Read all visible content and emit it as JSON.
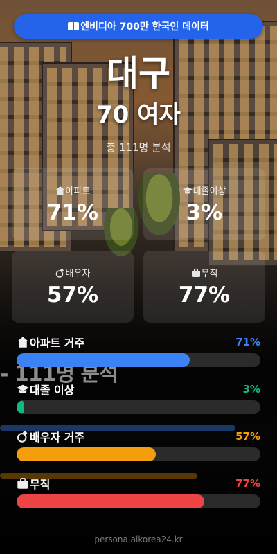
{
  "header": {
    "badge_label": "엔비디아 700만 한국인 데이터",
    "city": "대구",
    "persona": "70 여자",
    "total": "총 111명 분석"
  },
  "cards": [
    {
      "icon": "house-icon",
      "label": "아파트",
      "value": "71%"
    },
    {
      "icon": "graduation-cap-icon",
      "label": "대졸이상",
      "value": "3%"
    },
    {
      "icon": "ring-icon",
      "label": "배우자",
      "value": "57%"
    },
    {
      "icon": "briefcase-icon",
      "label": "무직",
      "value": "77%"
    }
  ],
  "progress": [
    {
      "icon": "house-icon",
      "label": "아파트 거주",
      "percent_text": "71%",
      "percent": 71,
      "color": "#3b82f6"
    },
    {
      "icon": "graduation-cap-icon",
      "label": "대졸 이상",
      "percent_text": "3%",
      "percent": 3,
      "color": "#10b981"
    },
    {
      "icon": "ring-icon",
      "label": "배우자 거주",
      "percent_text": "57%",
      "percent": 57,
      "color": "#f59e0b"
    },
    {
      "icon": "briefcase-icon",
      "label": "무직",
      "percent_text": "77%",
      "percent": 77,
      "color": "#ef4444"
    }
  ],
  "colors": {
    "badge": "#2563eb",
    "track": "#2b2b2b"
  },
  "footer": "persona.aikorea24.kr"
}
